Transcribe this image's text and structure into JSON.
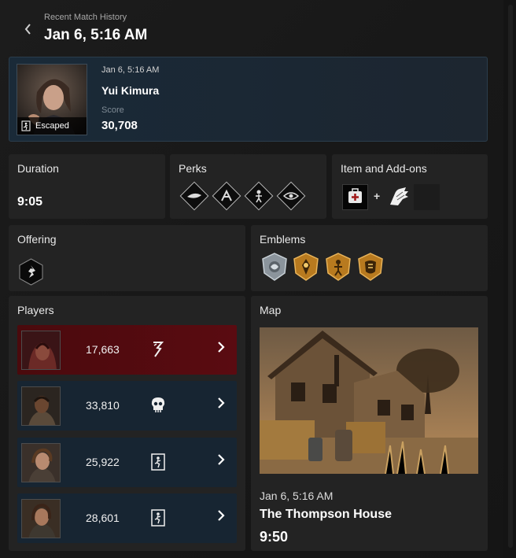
{
  "header": {
    "subtitle": "Recent Match History",
    "title": "Jan 6, 5:16 AM"
  },
  "player_card": {
    "time": "Jan 6, 5:16 AM",
    "name": "Yui Kimura",
    "score_label": "Score",
    "score": "30,708",
    "status": "Escaped"
  },
  "duration": {
    "label": "Duration",
    "value": "9:05"
  },
  "perks": {
    "label": "Perks",
    "icons": [
      "perk-1-icon",
      "perk-2-icon",
      "perk-3-icon",
      "perk-4-icon"
    ]
  },
  "items": {
    "label": "Item and Add-ons",
    "plus": "+",
    "item_icon": "medkit-icon",
    "addon_icons": [
      "gloves-icon"
    ]
  },
  "offering": {
    "label": "Offering",
    "icon": "offering-icon"
  },
  "emblems": {
    "label": "Emblems",
    "icons": [
      "iridescent-emblem-icon",
      "gold-emblem-icon",
      "gold-emblem-icon",
      "gold-emblem-icon"
    ],
    "colors": {
      "silver": "#9aa4ad",
      "gold": "#c98a2b"
    }
  },
  "players": {
    "label": "Players",
    "rows": [
      {
        "role": "killer",
        "score": "17,663",
        "status_icon": "sacrifice-icon"
      },
      {
        "role": "survivor",
        "score": "33,810",
        "status_icon": "skull-icon"
      },
      {
        "role": "survivor",
        "score": "25,922",
        "status_icon": "escaped-icon"
      },
      {
        "role": "survivor",
        "score": "28,601",
        "status_icon": "escaped-icon"
      }
    ]
  },
  "map": {
    "label": "Map",
    "time": "Jan 6, 5:16 AM",
    "name": "The Thompson House",
    "duration": "9:50"
  },
  "colors": {
    "killer_row": "#5a0b11",
    "survivor_row": "#172532",
    "card_bg": "#1a2a38"
  }
}
